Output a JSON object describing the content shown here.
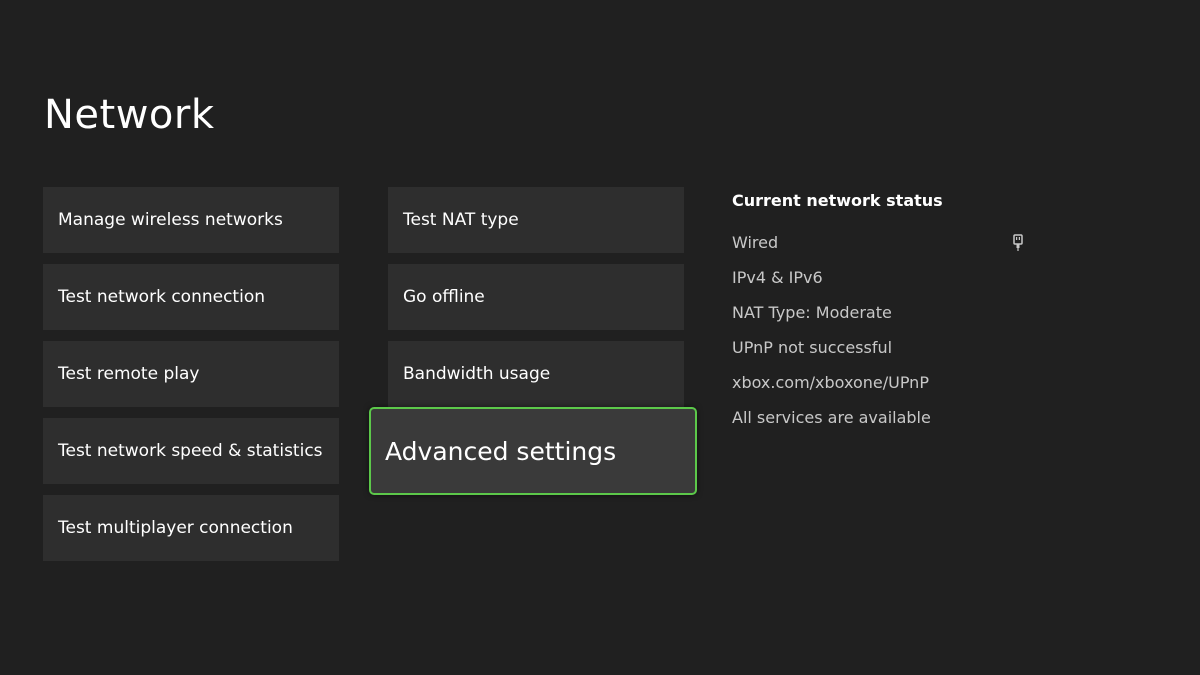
{
  "page": {
    "title": "Network"
  },
  "menu": {
    "column1": [
      {
        "label": "Manage wireless networks"
      },
      {
        "label": "Test network connection"
      },
      {
        "label": "Test remote play"
      },
      {
        "label": "Test network speed & statistics"
      },
      {
        "label": "Test multiplayer connection"
      }
    ],
    "column2": [
      {
        "label": "Test NAT type"
      },
      {
        "label": "Go offline"
      },
      {
        "label": "Bandwidth usage"
      },
      {
        "label": "Advanced settings",
        "focused": true
      }
    ]
  },
  "status": {
    "heading": "Current network status",
    "lines": [
      {
        "text": "Wired",
        "icon": "ethernet-icon"
      },
      {
        "text": "IPv4 & IPv6"
      },
      {
        "text": "NAT Type: Moderate"
      },
      {
        "text": "UPnP not successful"
      },
      {
        "text": "xbox.com/xboxone/UPnP"
      },
      {
        "text": "All services are available"
      }
    ]
  },
  "colors": {
    "background": "#202020",
    "tile": "#2e2e2e",
    "focus_border": "#5cc84a",
    "status_text": "#c8c8c8"
  }
}
